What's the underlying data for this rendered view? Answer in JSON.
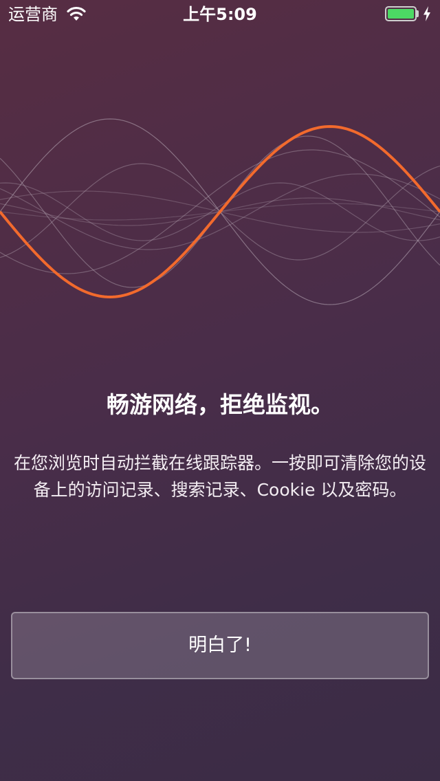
{
  "status_bar": {
    "carrier": "运营商",
    "time": "上午5:09",
    "battery_level": 1.0,
    "battery_color": "#4cd964",
    "charging": true,
    "icons": [
      "wifi-icon",
      "battery-icon",
      "charging-bolt-icon"
    ]
  },
  "illustration": {
    "name": "sound-wave-illustration",
    "accent_color": "#f26a2d",
    "line_color": "#b8aab6"
  },
  "main": {
    "headline": "畅游网络，拒绝监视。",
    "description": "在您浏览时自动拦截在线跟踪器。一按即可清除您的设备上的访问记录、搜索记录、Cookie 以及密码。",
    "button_label": "明白了!"
  },
  "theme": {
    "background_from": "#572d43",
    "background_to": "#3b2c45"
  }
}
